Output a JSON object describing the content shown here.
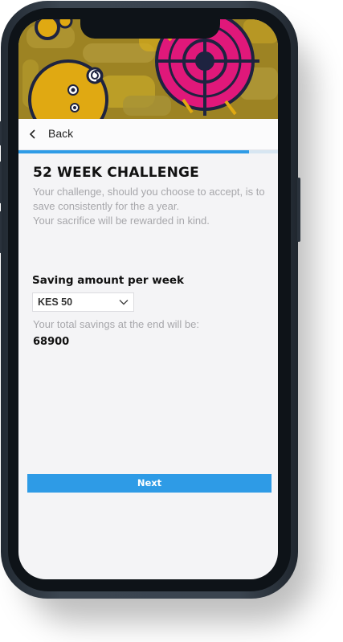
{
  "hero": {
    "icons": [
      "smiley-character-icon",
      "target-icon"
    ]
  },
  "nav": {
    "back_label": "Back",
    "back_icon": "chevron-left-icon"
  },
  "progress": {
    "fraction": 0.89
  },
  "challenge": {
    "title": "52 WEEK CHALLENGE",
    "description_line1": "Your challenge, should you choose to accept, is to save consistently for the a year.",
    "description_line2": "Your sacrifice will be rewarded in kind."
  },
  "saving": {
    "label": "Saving amount per week",
    "selected_value": "KES 50",
    "dropdown_icon": "chevron-down-icon"
  },
  "total": {
    "label": "Your total savings at the end will be:",
    "value": "68900"
  },
  "actions": {
    "next_label": "Next"
  },
  "colors": {
    "accent": "#2e9be6",
    "hero_bg": "#9d8323",
    "hero_mustard": "#e0a912",
    "target_magenta": "#e0187a",
    "phone_frame": "#3a444f"
  }
}
